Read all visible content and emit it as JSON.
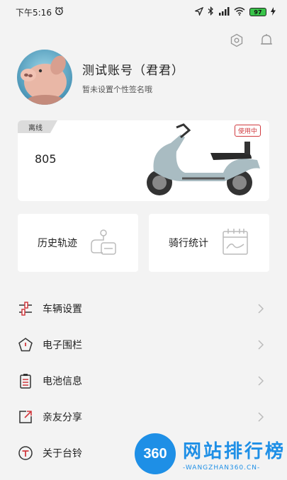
{
  "status_bar": {
    "time": "下午5:16",
    "battery": "97"
  },
  "header": {
    "settings_icon": "hexagon-settings-icon",
    "bell_icon": "bell-icon"
  },
  "profile": {
    "username": "测试账号（君君）",
    "signature": "暂未设置个性签名哦"
  },
  "vehicle": {
    "status_tag": "离线",
    "plate": "805",
    "usage_tag": "使用中"
  },
  "tiles": [
    {
      "label": "历史轨迹",
      "icon": "route-icon"
    },
    {
      "label": "骑行统计",
      "icon": "calendar-chart-icon"
    }
  ],
  "menu": [
    {
      "label": "车辆设置",
      "icon": "sliders-icon"
    },
    {
      "label": "电子围栏",
      "icon": "pentagon-fence-icon"
    },
    {
      "label": "电池信息",
      "icon": "battery-clipboard-icon"
    },
    {
      "label": "亲友分享",
      "icon": "share-arrow-icon"
    },
    {
      "label": "关于台铃",
      "icon": "brand-circle-icon"
    }
  ],
  "watermark": {
    "logo_text": "360",
    "title": "网站排行榜",
    "subtitle": "-WANGZHAN360.CN-"
  },
  "colors": {
    "accent": "#d0393e",
    "background": "#f3f3f3",
    "watermark": "#1e8fe6"
  }
}
